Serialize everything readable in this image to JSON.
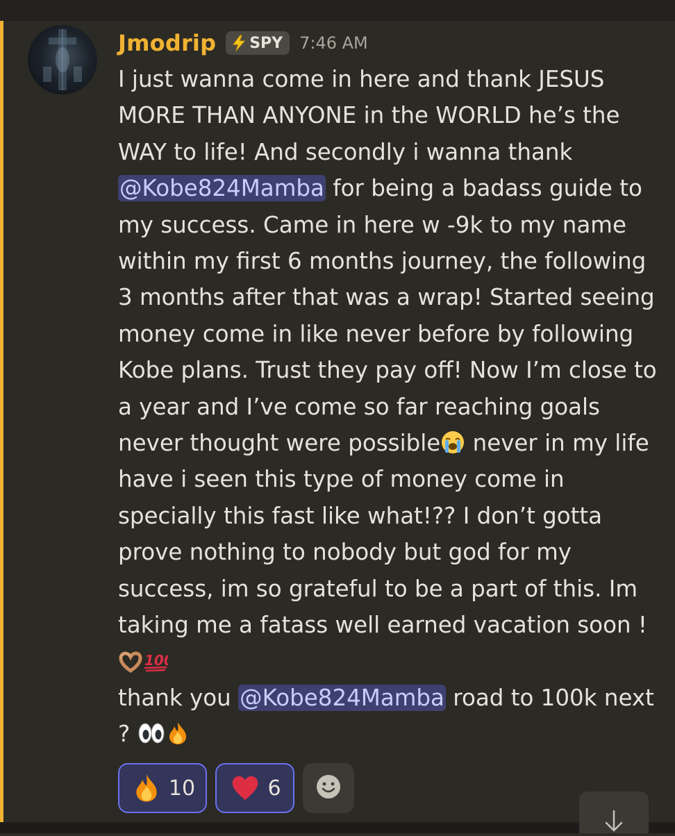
{
  "message": {
    "author": "Jmodrip",
    "role_tag": "SPY",
    "timestamp": "7:46 AM",
    "username_color": "#f0b232",
    "mention_color": "#c9cdfb",
    "content": {
      "t1": "I just wanna come in here and thank JESUS MORE THAN ANYONE in the WORLD he’s the WAY to life! And secondly i wanna thank ",
      "mention1": "@Kobe824Mamba",
      "t2": " for being a badass guide to my success. Came in here w -9k to my name within my first 6 months journey, the following 3 months after that was a wrap! Started seeing money come in like never before by following Kobe plans. Trust they pay off! Now I’m close to a year and I’ve come so far reaching goals never thought were possible",
      "emoji1": "loudly-crying-face",
      "t3": " never in my life have i seen this type of money come in specially this fast like what!?? I don’t gotta prove nothing to nobody but god for my success, im so grateful to be a part of this. Im taking me a fatass well earned vacation soon ! ",
      "emoji2": "heart-hands",
      "emoji3": "hundred-points",
      "t4": "\nthank you ",
      "mention2": "@Kobe824Mamba",
      "t5": " road to 100k next ? ",
      "emoji4": "eyes",
      "emoji5": "fire"
    }
  },
  "reactions": [
    {
      "emoji": "fire",
      "count": "10",
      "selected": true
    },
    {
      "emoji": "red-heart",
      "count": "6",
      "selected": true
    }
  ],
  "add_reaction_icon": "smiley-add-reaction-icon",
  "scroll_icon": "arrow-down-icon"
}
